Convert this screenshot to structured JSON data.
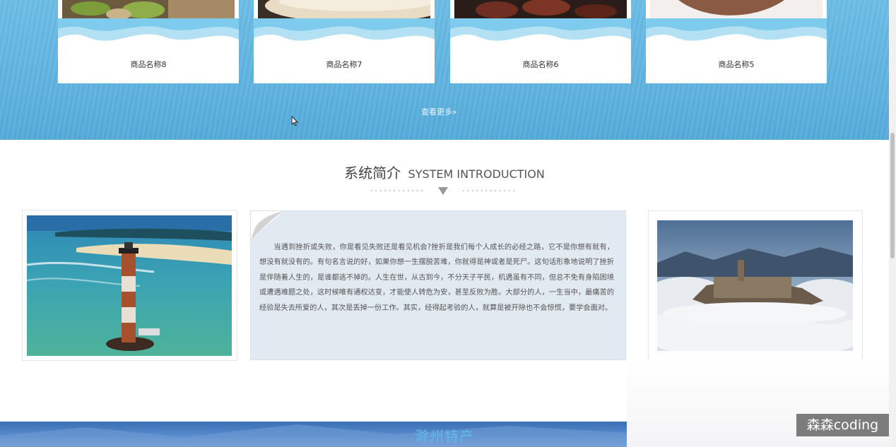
{
  "products": [
    {
      "name": "商品名称8",
      "photo": "salad-photo"
    },
    {
      "name": "商品名称7",
      "photo": "bread-photo"
    },
    {
      "name": "商品名称6",
      "photo": "dried-meat-photo"
    },
    {
      "name": "商品名称5",
      "photo": "dish-photo"
    }
  ],
  "view_more": "查看更多»",
  "intro": {
    "title_cn": "系统简介",
    "title_en": "SYSTEM INTRODUCTION",
    "text": "当遇到挫折或失败，你是看见失败还是看见机会?挫折是我们每个人成长的必经之路，它不是你想有就有，想没有就没有的。有句名言说的好，如果你想一生摆脱苦难，你就得是神或者是死尸。这句话形象地说明了挫折是伴随着人生的，是谁都逃不掉的。人生在世，从古到今，不分天子平民，机遇虽有不同，但总不免有身陷困境或遭遇难题之处，这时候唯有通权达变，才能使人转危为安，甚至反败为胜。大部分的人，一生当中，最痛苦的经验是失去所爱的人，其次是丢掉一份工作。其实，经得起考验的人，就算是被开除也不会惊慌，要学会面对。",
    "left_image": "lighthouse-photo",
    "right_image": "castle-in-clouds-photo"
  },
  "next_section": {
    "title": "滁州特产"
  },
  "watermark": "森森coding",
  "colors": {
    "band": "#5fb3e0",
    "textbox": "#e1e9f1",
    "banner": "#3a6fb4"
  }
}
